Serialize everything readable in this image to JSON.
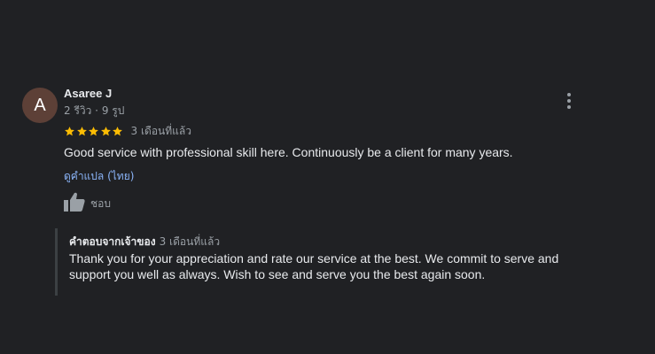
{
  "review": {
    "avatar_letter": "A",
    "avatar_color": "#5d4037",
    "author_name": "Asaree J",
    "author_meta": "2 รีวิว · 9 รูป",
    "rating": 5,
    "star_color": "#fbbc04",
    "relative_time": "3 เดือนที่แล้ว",
    "text": "Good service with professional skill here. Continuously be a client for many years.",
    "translate_link": "ดูคำแปล (ไทย)",
    "like_label": "ชอบ",
    "more_icon": "more-vert-icon",
    "like_icon": "thumbs-up-icon"
  },
  "reply": {
    "owner_label": "คำตอบจากเจ้าของ",
    "relative_time": "3 เดือนที่แล้ว",
    "text": "Thank you for your appreciation and rate our service at the best. We commit to serve and support you well as always. Wish to see and serve you the best again soon."
  }
}
